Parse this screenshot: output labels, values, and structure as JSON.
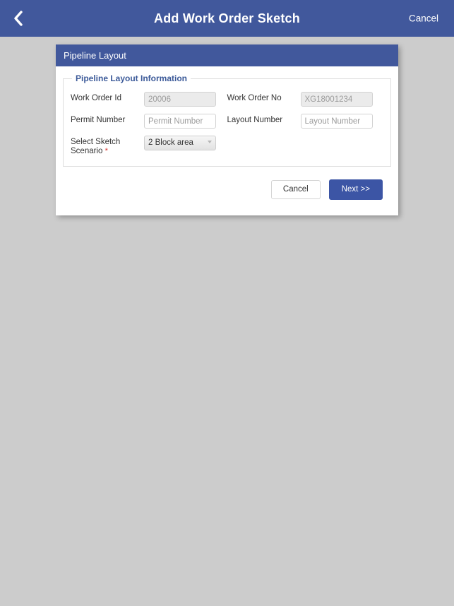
{
  "appbar": {
    "back_icon": "chevron-left-icon",
    "title": "Add Work Order Sketch",
    "cancel_label": "Cancel",
    "background_color": "#41589c",
    "text_color": "#ffffff"
  },
  "card": {
    "header_title": "Pipeline Layout",
    "group_legend": "Pipeline Layout Information",
    "fields": {
      "work_order_id": {
        "label": "Work Order Id",
        "value": "20006",
        "placeholder": "Work Order Id",
        "disabled": true
      },
      "work_order_no": {
        "label": "Work Order No",
        "value": "XG18001234",
        "placeholder": "Work Order No",
        "disabled": true
      },
      "permit_number": {
        "label": "Permit Number",
        "value": "",
        "placeholder": "Permit Number",
        "disabled": false
      },
      "layout_number": {
        "label": "Layout Number",
        "value": "",
        "placeholder": "Layout Number",
        "disabled": false
      },
      "sketch_scenario": {
        "label": "Select Sketch Scenario",
        "required_marker": "*",
        "selected": "2 Block area",
        "arrow_icon": "chevron-down-icon"
      }
    },
    "footer": {
      "cancel_label": "Cancel",
      "next_label": "Next >>"
    }
  },
  "theme": {
    "brand_blue": "#41589c",
    "button_blue": "#3c55a5",
    "legend_blue": "#3c5a99",
    "page_background": "#cccccc",
    "required_red": "#d9332e"
  }
}
